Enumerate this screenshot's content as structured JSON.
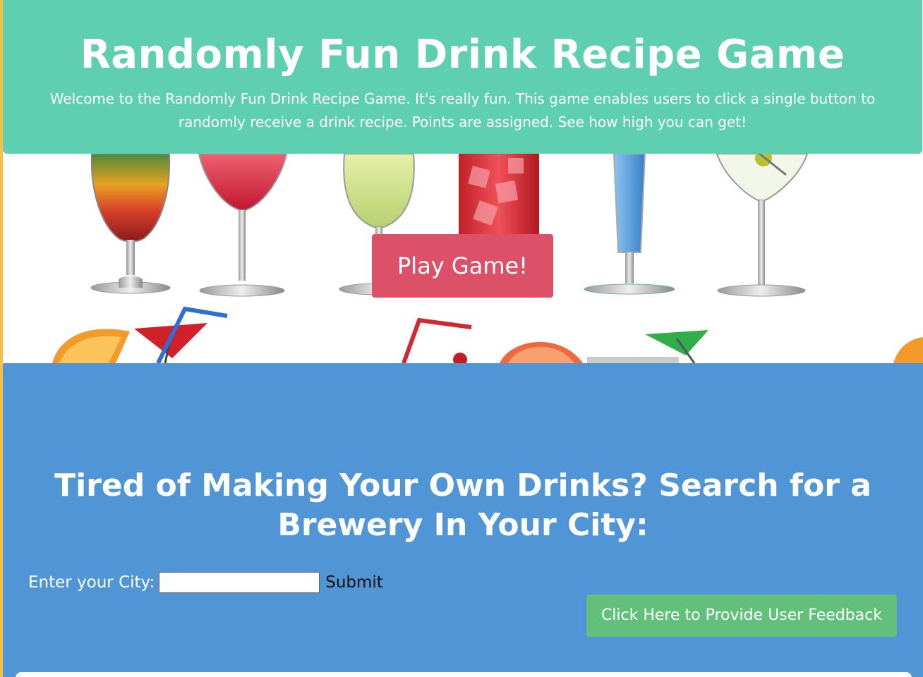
{
  "header": {
    "title": "Randomly Fun Drink Recipe Game",
    "description": "Welcome to the Randomly Fun Drink Recipe Game. It's really fun. This game enables users to click a single button to randomly receive a drink recipe. Points are assigned. See how high you can get!"
  },
  "hero": {
    "play_label": "Play Game!"
  },
  "brewery": {
    "heading": "Tired of Making Your Own Drinks? Search for a Brewery In Your City:",
    "city_label": "Enter your City:",
    "city_value": "",
    "submit_label": "Submit",
    "feedback_label": "Click Here to Provide User Feedback"
  },
  "colors": {
    "header_bg": "#5ecfb1",
    "play_button": "#dc5168",
    "brewery_bg": "#5095d6",
    "feedback_button": "#63c07a"
  }
}
